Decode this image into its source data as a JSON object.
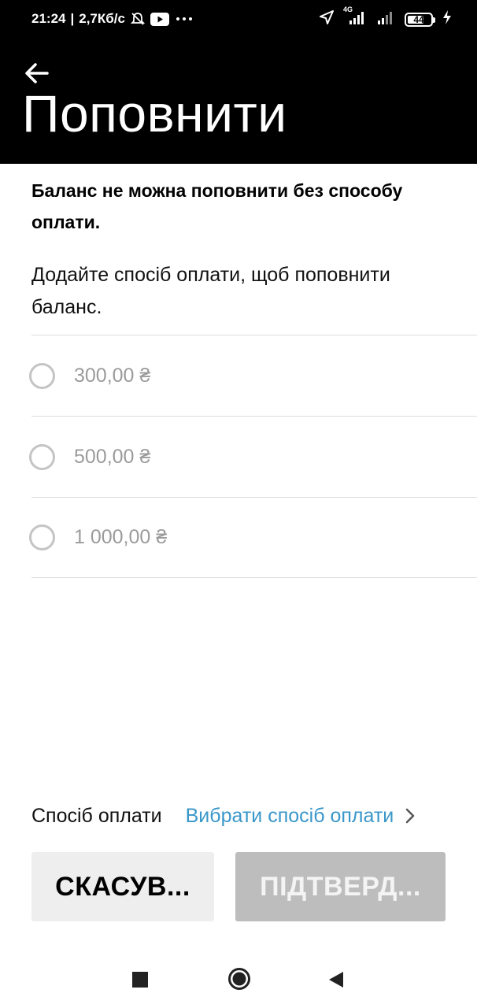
{
  "status_bar": {
    "time": "21:24",
    "speed": "2,7Кб/с",
    "network": "4G",
    "battery": "44",
    "icons": [
      "mute-icon",
      "youtube-icon",
      "more-icon",
      "location-icon",
      "signal-icon",
      "signal-icon",
      "battery-icon",
      "charging-icon"
    ]
  },
  "header": {
    "back_icon": "arrow-left-icon",
    "title": "Поповнити"
  },
  "content": {
    "warning": "Баланс не можна поповнити без способу оплати.",
    "hint": "Додайте спосіб оплати, щоб поповнити баланс.",
    "amounts": [
      {
        "label": "300,00 ₴",
        "selected": false
      },
      {
        "label": "500,00 ₴",
        "selected": false
      },
      {
        "label": "1 000,00 ₴",
        "selected": false
      }
    ]
  },
  "payment": {
    "label": "Спосіб оплати",
    "link": "Вибрати спосіб оплати",
    "link_color": "#3a97c9"
  },
  "buttons": {
    "cancel": "СКАСУВ...",
    "confirm": "ПІДТВЕРД..."
  },
  "navbar": {
    "icons": [
      "recents-square-icon",
      "home-circle-icon",
      "back-triangle-icon"
    ]
  }
}
